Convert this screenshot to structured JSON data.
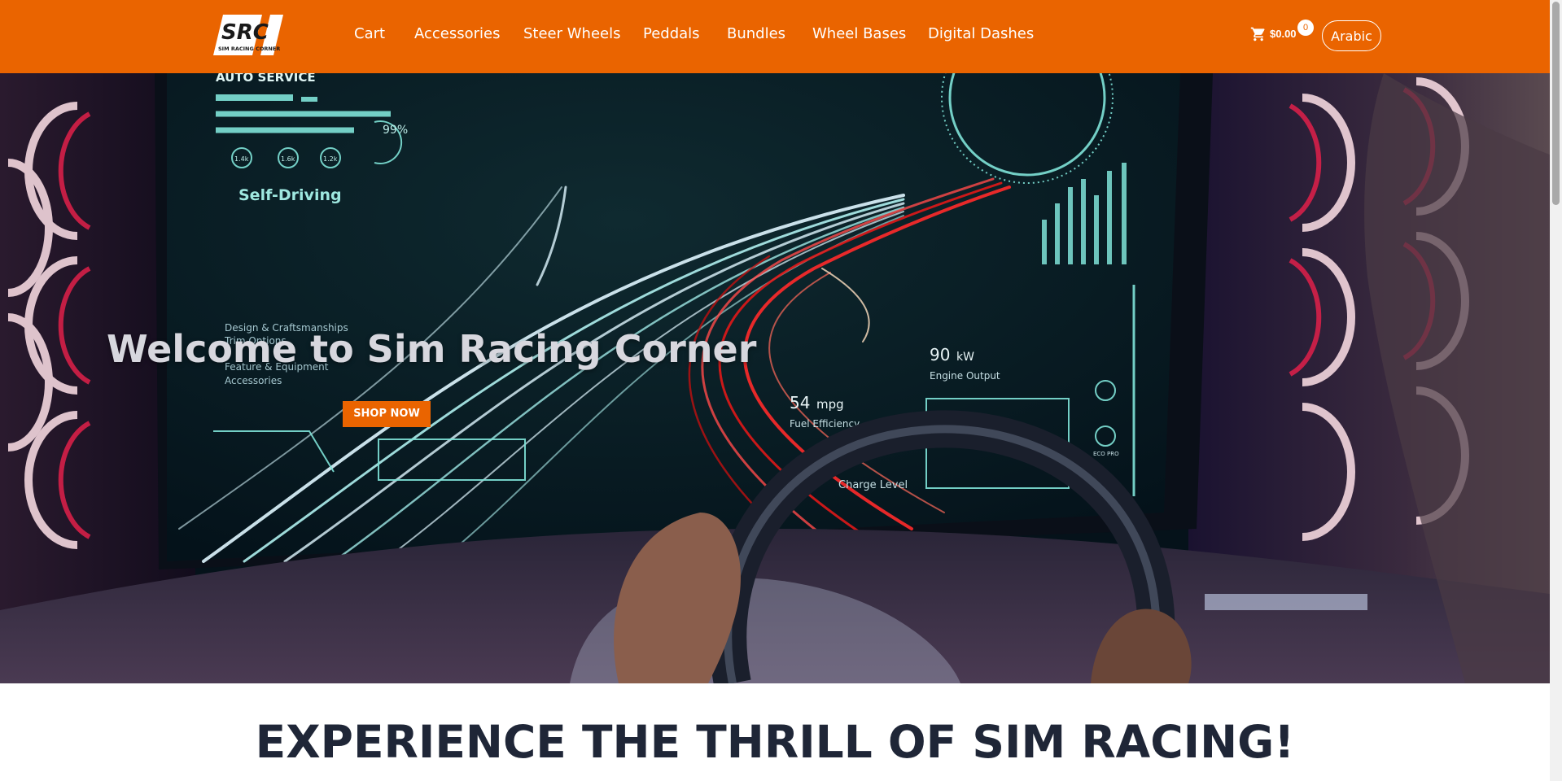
{
  "brand": {
    "logo_letters": "SRC",
    "logo_subtitle": "SIM RACING CORNER"
  },
  "nav": {
    "items": [
      {
        "label": "Cart"
      },
      {
        "label": "Accessories"
      },
      {
        "label": "Steer Wheels"
      },
      {
        "label": "Peddals"
      },
      {
        "label": "Bundles"
      },
      {
        "label": "Wheel Bases"
      },
      {
        "label": "Digital Dashes"
      }
    ],
    "cart_total": "$0.00",
    "cart_count": "0",
    "cart_icon": "cart-icon",
    "language_button": "Arabic"
  },
  "hero": {
    "title": "Welcome to Sim Racing Corner",
    "cta_label": "SHOP NOW",
    "screen_texts": {
      "auto_service": "AUTO SERVICE",
      "percent": "99%",
      "gauge_1": "1.4k",
      "gauge_2": "1.6k",
      "gauge_3": "1.2k",
      "self_driving": "Self-Driving",
      "design": "Design & Craftsmanships",
      "trim": "Trim Options",
      "feature": "Feature & Equipment",
      "accessories": "Accessories",
      "engine_value": "90",
      "engine_unit": "kW",
      "engine_label": "Engine Output",
      "fuel_value": "54",
      "fuel_unit": "mpg",
      "fuel_label": "Fuel Efficiency",
      "charge_label": "Charge Level",
      "eco_pro": "ECO PRO"
    }
  },
  "headline": "EXPERIENCE THE THRILL OF SIM RACING!",
  "colors": {
    "brand_orange": "#ea6400",
    "headline_text": "#1f2637",
    "screen_cyan": "#7fe3d8"
  }
}
